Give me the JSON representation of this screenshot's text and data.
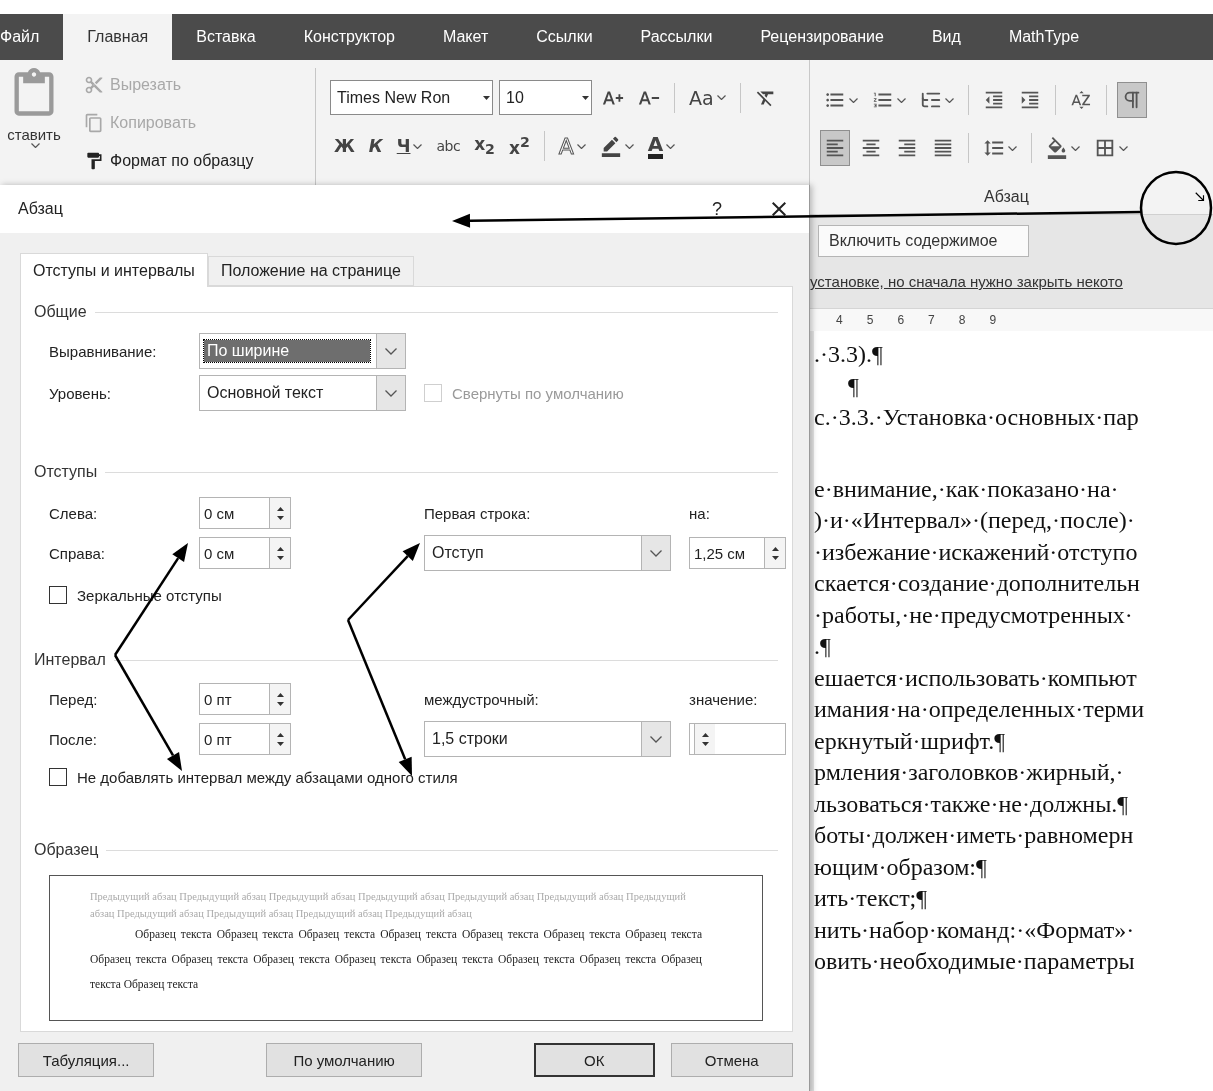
{
  "ribbon_tabs": [
    {
      "label": "Файл",
      "selected": false
    },
    {
      "label": "Главная",
      "selected": true
    },
    {
      "label": "Вставка",
      "selected": false
    },
    {
      "label": "Конструктор",
      "selected": false
    },
    {
      "label": "Макет",
      "selected": false
    },
    {
      "label": "Ссылки",
      "selected": false
    },
    {
      "label": "Рассылки",
      "selected": false
    },
    {
      "label": "Рецензирование",
      "selected": false
    },
    {
      "label": "Вид",
      "selected": false
    },
    {
      "label": "MathType",
      "selected": false
    }
  ],
  "clipboard": {
    "paste_label": "ставить",
    "commands": [
      {
        "kind": "cut",
        "label": "Вырезать",
        "disabled": true
      },
      {
        "kind": "copy",
        "label": "Копировать",
        "disabled": true
      },
      {
        "kind": "format_painter",
        "label": "Формат по образцу",
        "disabled": false
      }
    ]
  },
  "font": {
    "name": "Times New Ron",
    "size": "10",
    "row1": [
      {
        "kind": "grow"
      },
      {
        "kind": "shrink"
      },
      {
        "kind": "separator"
      },
      {
        "kind": "case",
        "label": "Aa",
        "dropdown": true
      },
      {
        "kind": "separator"
      },
      {
        "kind": "clear"
      }
    ],
    "row2": [
      {
        "kind": "bold",
        "label": "Ж",
        "dropdown": false
      },
      {
        "kind": "italic",
        "label": "К",
        "dropdown": false
      },
      {
        "kind": "underline",
        "label": "Ч",
        "dropdown": true
      },
      {
        "kind": "strike",
        "label": "abc",
        "dropdown": false
      },
      {
        "kind": "script",
        "label": "x$_{2}$",
        "dropdown": false
      },
      {
        "kind": "script",
        "label": "x$^{2}$",
        "dropdown": false
      },
      {
        "kind": "separator"
      },
      {
        "kind": "effects",
        "label": "A",
        "dropdown": true
      },
      {
        "kind": "highlight",
        "dropdown": true
      },
      {
        "kind": "color",
        "label": "A",
        "dropdown": true
      }
    ]
  },
  "paragraph": {
    "title": "Абзац",
    "row1": [
      {
        "kind": "bullets",
        "dropdown": true,
        "selected": false
      },
      {
        "kind": "numbering",
        "dropdown": true,
        "selected": false
      },
      {
        "kind": "multilevel",
        "dropdown": true,
        "selected": false
      },
      {
        "kind": "separator"
      },
      {
        "kind": "outdent",
        "dropdown": false,
        "selected": false
      },
      {
        "kind": "indent",
        "dropdown": false,
        "selected": false
      },
      {
        "kind": "separator"
      },
      {
        "kind": "sort",
        "dropdown": false,
        "selected": false
      },
      {
        "kind": "separator"
      },
      {
        "kind": "marks",
        "dropdown": false,
        "selected": true
      }
    ],
    "row2": [
      {
        "kind": "align_left",
        "dropdown": false,
        "selected": true
      },
      {
        "kind": "align_center",
        "dropdown": false,
        "selected": false
      },
      {
        "kind": "align_right",
        "dropdown": false,
        "selected": false
      },
      {
        "kind": "justify",
        "dropdown": false,
        "selected": false
      },
      {
        "kind": "separator"
      },
      {
        "kind": "line_spacing",
        "dropdown": true,
        "selected": false
      },
      {
        "kind": "separator"
      },
      {
        "kind": "shading",
        "dropdown": true,
        "selected": false
      },
      {
        "kind": "borders",
        "dropdown": true,
        "selected": false
      }
    ]
  },
  "protected_bar": {
    "button": "Включить содержимое",
    "message": "установке, но сначала нужно закрыть некото"
  },
  "ruler": [
    "4",
    "5",
    "6",
    "7",
    "8",
    "9"
  ],
  "document_blocks": [
    [
      {
        "text": ".·3.3).¶",
        "centered": false
      },
      {
        "text": "¶",
        "centered": true
      },
      {
        "text": "с.·3.3.·Установка·основных·пар",
        "centered": false
      }
    ],
    [
      {
        "text": "е·внимание,·как·показано·на·",
        "centered": false
      },
      {
        "text": ")·и·«Интервал»·(перед,·после)·",
        "centered": false
      },
      {
        "text": "·избежание·искажений·отступо",
        "centered": false
      },
      {
        "text": "скается·создание·дополнительн",
        "centered": false
      },
      {
        "text": "·работы,·не·предусмотренных·",
        "centered": false
      },
      {
        "text": ".¶",
        "centered": false
      },
      {
        "text": "ешается·использовать·компьют",
        "centered": false
      },
      {
        "text": "имания·на·определенных·терми",
        "centered": false
      },
      {
        "text": "еркнутый·шрифт.¶",
        "centered": false
      },
      {
        "text": "рмления·заголовков·жирный,·",
        "centered": false
      },
      {
        "text": "льзоваться·также·не·должны.¶",
        "centered": false
      },
      {
        "text": "боты·должен·иметь·равномерн",
        "centered": false
      },
      {
        "text": "ющим·образом:¶",
        "centered": false
      },
      {
        "text": "ить·текст;¶",
        "centered": false
      },
      {
        "text": "нить·набор·команд:·«Формат»·",
        "centered": false
      },
      {
        "text": "овить·необходимые·параметры",
        "centered": false
      }
    ]
  ],
  "dialog": {
    "title": "Абзац",
    "help": "?",
    "tabs": [
      {
        "label": "Отступы и интервалы",
        "selected": true
      },
      {
        "label": "Положение на странице",
        "selected": false
      }
    ],
    "general": {
      "title": "Общие",
      "alignment": {
        "label": "Выравнивание:",
        "value": "По ширине",
        "focused": true
      },
      "level": {
        "label": "Уровень:",
        "value": "Основной текст",
        "focused": false
      },
      "collapsed": {
        "label": "Свернуты по умолчанию",
        "checked": false,
        "disabled": true
      }
    },
    "indents": {
      "title": "Отступы",
      "left": {
        "label": "Слева:",
        "value": "0 см"
      },
      "right": {
        "label": "Справа:",
        "value": "0 см"
      },
      "first_line": {
        "label": "Первая строка:",
        "value": "Отступ"
      },
      "by": {
        "label": "на:",
        "value": "1,25 см"
      },
      "mirror": {
        "label": "Зеркальные отступы",
        "checked": false,
        "disabled": false
      }
    },
    "spacing": {
      "title": "Интервал",
      "before": {
        "label": "Перед:",
        "value": "0 пт"
      },
      "after": {
        "label": "После:",
        "value": "0 пт"
      },
      "line": {
        "label": "междустрочный:",
        "value": "1,5 строки"
      },
      "at": {
        "label": "значение:"
      },
      "no_space": {
        "label": "Не добавлять интервал между абзацами одного стиля",
        "checked": false,
        "disabled": false
      }
    },
    "preview": {
      "title": "Образец",
      "previous": "Предыдущий абзац Предыдущий абзац Предыдущий абзац Предыдущий абзац Предыдущий абзац Предыдущий абзац Предыдущий абзац Предыдущий абзац Предыдущий абзац Предыдущий абзац Предыдущий абзац",
      "sample": "Образец текста Образец текста Образец текста Образец текста Образец текста Образец текста Образец текста Образец текста Образец текста Образец текста Образец текста Образец текста Образец текста Образец текста Образец текста Образец текста"
    },
    "buttons": [
      {
        "label": "Табуляция...",
        "default": false
      },
      {
        "label": "По умолчанию",
        "default": false
      },
      {
        "label": "ОК",
        "default": true
      },
      {
        "label": "Отмена",
        "default": false
      }
    ]
  }
}
